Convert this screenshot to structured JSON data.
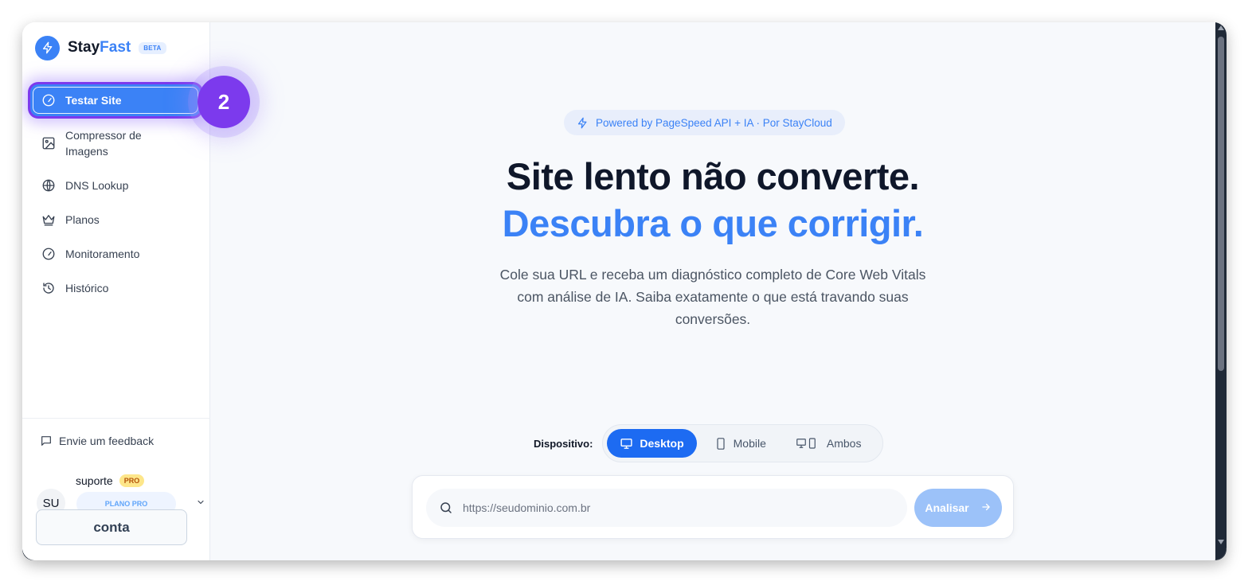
{
  "brand": {
    "name_part1": "Stay",
    "name_part2": "Fast",
    "badge": "BETA",
    "logo_icon": "bolt-icon"
  },
  "sidebar": {
    "items": [
      {
        "label": "Testar Site",
        "icon": "gauge-icon",
        "active": true
      },
      {
        "label": "Compressor de Imagens",
        "icon": "image-icon",
        "active": false
      },
      {
        "label": "DNS Lookup",
        "icon": "globe-icon",
        "active": false
      },
      {
        "label": "Planos",
        "icon": "crown-icon",
        "active": false
      },
      {
        "label": "Monitoramento",
        "icon": "gauge-icon",
        "active": false
      },
      {
        "label": "Histórico",
        "icon": "history-icon",
        "active": false
      }
    ],
    "feedback": "Envie um feedback",
    "user": {
      "initials": "SU",
      "name": "suporte",
      "badge": "PRO",
      "plan": "PLANO PRO"
    },
    "account_button": "conta"
  },
  "step_marker": "2",
  "hero": {
    "powered": "Powered by PageSpeed API + IA · Por StayCloud",
    "title_line1": "Site lento não converte.",
    "title_line2": "Descubra o que corrigir.",
    "description": "Cole sua URL e receba um diagnóstico completo de Core Web Vitals com análise de IA. Saiba exatamente o que está travando suas conversões."
  },
  "device": {
    "label": "Dispositivo:",
    "options": [
      "Desktop",
      "Mobile",
      "Ambos"
    ],
    "selected": "Desktop"
  },
  "search": {
    "placeholder": "https://seudominio.com.br",
    "value": "",
    "button": "Analisar"
  },
  "colors": {
    "accent": "#3b82f6",
    "highlight": "#7c3aed",
    "button_disabled": "#9cc2f9"
  }
}
